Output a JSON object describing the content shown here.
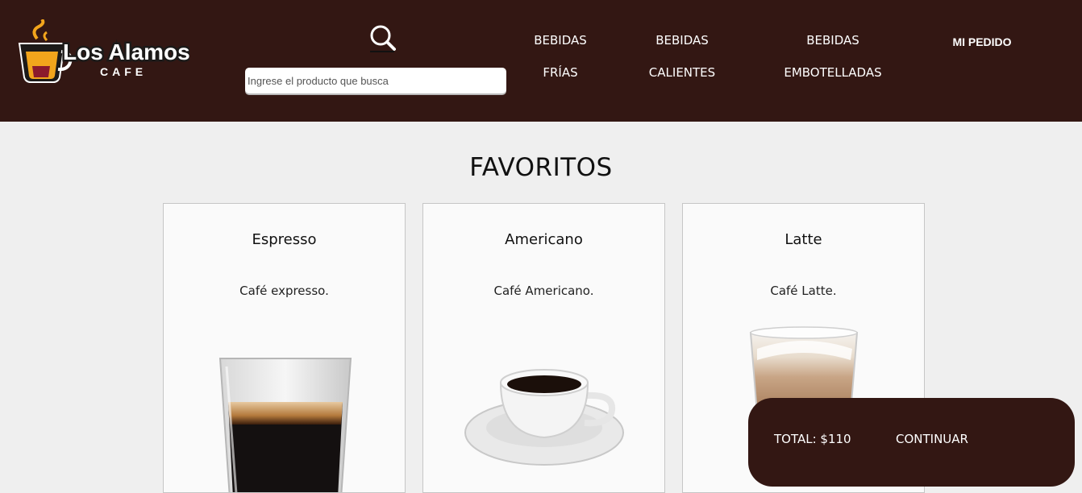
{
  "brand": {
    "name": "Los Alamos",
    "sub": "CAFE",
    "name_color": "#ffffff",
    "accent": "#f2a51c"
  },
  "search": {
    "placeholder": "Ingrese el producto que busca",
    "value": ""
  },
  "nav": [
    {
      "line1": "BEBIDAS",
      "line2": "FRÍAS"
    },
    {
      "line1": "BEBIDAS",
      "line2": "CALIENTES"
    },
    {
      "line1": "BEBIDAS",
      "line2": "EMBOTELLADAS"
    }
  ],
  "order_link": "MI PEDIDO",
  "section_title": "FAVORITOS",
  "favorites": [
    {
      "title": "Espresso",
      "description": "Café expresso.",
      "image": "espresso-glass"
    },
    {
      "title": "Americano",
      "description": "Café Americano.",
      "image": "coffee-cup-saucer"
    },
    {
      "title": "Latte",
      "description": "Café Latte.",
      "image": "latte-glass"
    }
  ],
  "cart": {
    "total_label": "TOTAL: $110",
    "continue_label": "CONTINUAR"
  },
  "colors": {
    "header_bg": "#331713",
    "page_bg": "#efefef",
    "card_bg": "#fafafa"
  }
}
